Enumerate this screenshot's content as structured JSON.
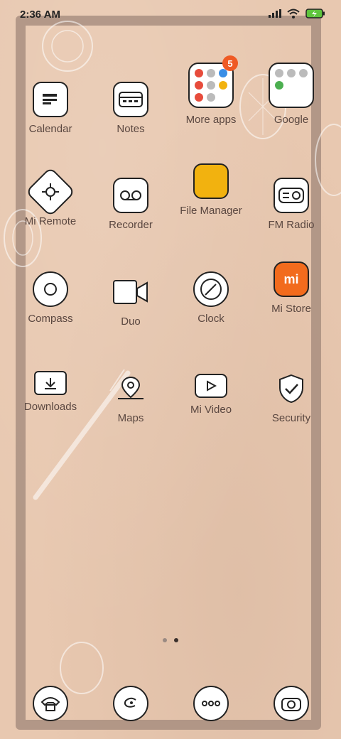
{
  "status": {
    "time": "2:36 AM"
  },
  "apps": [
    {
      "id": "calendar",
      "label": "Calendar"
    },
    {
      "id": "notes",
      "label": "Notes"
    },
    {
      "id": "more-apps",
      "label": "More apps",
      "badge": "5"
    },
    {
      "id": "google",
      "label": "Google"
    },
    {
      "id": "mi-remote",
      "label": "Mi Remote"
    },
    {
      "id": "recorder",
      "label": "Recorder"
    },
    {
      "id": "file-manager",
      "label": "File Manager"
    },
    {
      "id": "fm-radio",
      "label": "FM Radio"
    },
    {
      "id": "compass",
      "label": "Compass"
    },
    {
      "id": "duo",
      "label": "Duo"
    },
    {
      "id": "clock",
      "label": "Clock"
    },
    {
      "id": "mi-store",
      "label": "Mi Store",
      "logo": "mi"
    },
    {
      "id": "downloads",
      "label": "Downloads"
    },
    {
      "id": "maps",
      "label": "Maps"
    },
    {
      "id": "mi-video",
      "label": "Mi Video"
    },
    {
      "id": "security",
      "label": "Security"
    }
  ],
  "dock": [
    {
      "id": "phone",
      "icon": "phone-icon"
    },
    {
      "id": "contacts",
      "icon": "contacts-icon"
    },
    {
      "id": "messages",
      "icon": "messages-icon"
    },
    {
      "id": "camera",
      "icon": "camera-icon"
    }
  ],
  "pager": {
    "pages": 2,
    "current": 2
  },
  "colors": {
    "badge": "#ef5a24",
    "file_manager": "#f2b20f",
    "mi_store": "#f26b1d",
    "frame": "#a0877a",
    "background": "#e8c8b0"
  }
}
